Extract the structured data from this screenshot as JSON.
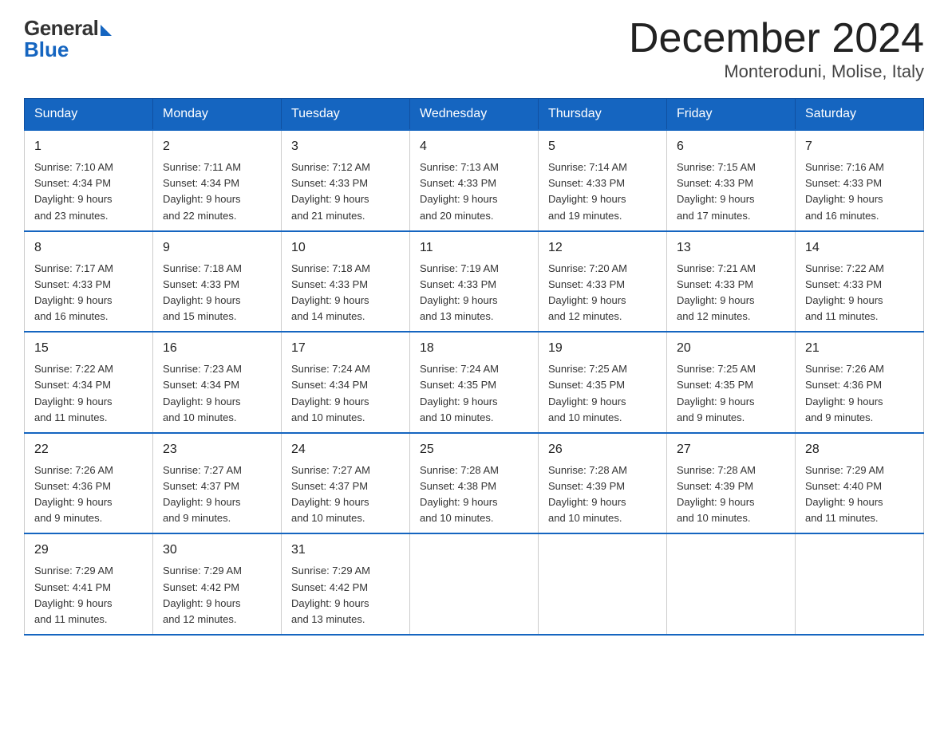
{
  "logo": {
    "general": "General",
    "blue": "Blue"
  },
  "title": "December 2024",
  "location": "Monteroduni, Molise, Italy",
  "days_of_week": [
    "Sunday",
    "Monday",
    "Tuesday",
    "Wednesday",
    "Thursday",
    "Friday",
    "Saturday"
  ],
  "weeks": [
    [
      {
        "day": "1",
        "sunrise": "7:10 AM",
        "sunset": "4:34 PM",
        "daylight": "9 hours and 23 minutes."
      },
      {
        "day": "2",
        "sunrise": "7:11 AM",
        "sunset": "4:34 PM",
        "daylight": "9 hours and 22 minutes."
      },
      {
        "day": "3",
        "sunrise": "7:12 AM",
        "sunset": "4:33 PM",
        "daylight": "9 hours and 21 minutes."
      },
      {
        "day": "4",
        "sunrise": "7:13 AM",
        "sunset": "4:33 PM",
        "daylight": "9 hours and 20 minutes."
      },
      {
        "day": "5",
        "sunrise": "7:14 AM",
        "sunset": "4:33 PM",
        "daylight": "9 hours and 19 minutes."
      },
      {
        "day": "6",
        "sunrise": "7:15 AM",
        "sunset": "4:33 PM",
        "daylight": "9 hours and 17 minutes."
      },
      {
        "day": "7",
        "sunrise": "7:16 AM",
        "sunset": "4:33 PM",
        "daylight": "9 hours and 16 minutes."
      }
    ],
    [
      {
        "day": "8",
        "sunrise": "7:17 AM",
        "sunset": "4:33 PM",
        "daylight": "9 hours and 16 minutes."
      },
      {
        "day": "9",
        "sunrise": "7:18 AM",
        "sunset": "4:33 PM",
        "daylight": "9 hours and 15 minutes."
      },
      {
        "day": "10",
        "sunrise": "7:18 AM",
        "sunset": "4:33 PM",
        "daylight": "9 hours and 14 minutes."
      },
      {
        "day": "11",
        "sunrise": "7:19 AM",
        "sunset": "4:33 PM",
        "daylight": "9 hours and 13 minutes."
      },
      {
        "day": "12",
        "sunrise": "7:20 AM",
        "sunset": "4:33 PM",
        "daylight": "9 hours and 12 minutes."
      },
      {
        "day": "13",
        "sunrise": "7:21 AM",
        "sunset": "4:33 PM",
        "daylight": "9 hours and 12 minutes."
      },
      {
        "day": "14",
        "sunrise": "7:22 AM",
        "sunset": "4:33 PM",
        "daylight": "9 hours and 11 minutes."
      }
    ],
    [
      {
        "day": "15",
        "sunrise": "7:22 AM",
        "sunset": "4:34 PM",
        "daylight": "9 hours and 11 minutes."
      },
      {
        "day": "16",
        "sunrise": "7:23 AM",
        "sunset": "4:34 PM",
        "daylight": "9 hours and 10 minutes."
      },
      {
        "day": "17",
        "sunrise": "7:24 AM",
        "sunset": "4:34 PM",
        "daylight": "9 hours and 10 minutes."
      },
      {
        "day": "18",
        "sunrise": "7:24 AM",
        "sunset": "4:35 PM",
        "daylight": "9 hours and 10 minutes."
      },
      {
        "day": "19",
        "sunrise": "7:25 AM",
        "sunset": "4:35 PM",
        "daylight": "9 hours and 10 minutes."
      },
      {
        "day": "20",
        "sunrise": "7:25 AM",
        "sunset": "4:35 PM",
        "daylight": "9 hours and 9 minutes."
      },
      {
        "day": "21",
        "sunrise": "7:26 AM",
        "sunset": "4:36 PM",
        "daylight": "9 hours and 9 minutes."
      }
    ],
    [
      {
        "day": "22",
        "sunrise": "7:26 AM",
        "sunset": "4:36 PM",
        "daylight": "9 hours and 9 minutes."
      },
      {
        "day": "23",
        "sunrise": "7:27 AM",
        "sunset": "4:37 PM",
        "daylight": "9 hours and 9 minutes."
      },
      {
        "day": "24",
        "sunrise": "7:27 AM",
        "sunset": "4:37 PM",
        "daylight": "9 hours and 10 minutes."
      },
      {
        "day": "25",
        "sunrise": "7:28 AM",
        "sunset": "4:38 PM",
        "daylight": "9 hours and 10 minutes."
      },
      {
        "day": "26",
        "sunrise": "7:28 AM",
        "sunset": "4:39 PM",
        "daylight": "9 hours and 10 minutes."
      },
      {
        "day": "27",
        "sunrise": "7:28 AM",
        "sunset": "4:39 PM",
        "daylight": "9 hours and 10 minutes."
      },
      {
        "day": "28",
        "sunrise": "7:29 AM",
        "sunset": "4:40 PM",
        "daylight": "9 hours and 11 minutes."
      }
    ],
    [
      {
        "day": "29",
        "sunrise": "7:29 AM",
        "sunset": "4:41 PM",
        "daylight": "9 hours and 11 minutes."
      },
      {
        "day": "30",
        "sunrise": "7:29 AM",
        "sunset": "4:42 PM",
        "daylight": "9 hours and 12 minutes."
      },
      {
        "day": "31",
        "sunrise": "7:29 AM",
        "sunset": "4:42 PM",
        "daylight": "9 hours and 13 minutes."
      },
      null,
      null,
      null,
      null
    ]
  ],
  "labels": {
    "sunrise": "Sunrise:",
    "sunset": "Sunset:",
    "daylight": "Daylight:"
  }
}
